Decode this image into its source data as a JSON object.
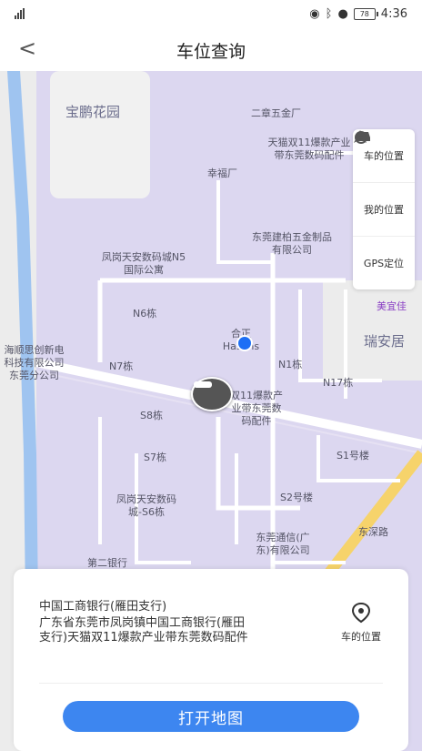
{
  "status_bar": {
    "time": "4:36",
    "battery": "78"
  },
  "header": {
    "back_label": "<",
    "title": "车位查询"
  },
  "map": {
    "pois": {
      "baopeng": "宝鹏花园",
      "erzhang": "二章五金厂",
      "tianmao": "天猫双11爆款产业带东莞数码配件",
      "xingfu": "幸福厂",
      "fenggang": "凤岗天安数码城N5国际公寓",
      "dongguan_jianbai": "东莞建柏五金制品有限公司",
      "meiyijia": "美宜佳",
      "n6": "N6栋",
      "hezheng": "合正Hasons",
      "ruian": "瑞安居",
      "n7": "N7栋",
      "n1": "N1栋",
      "n17": "N17栋",
      "keji": "海顺思创新电科技有限公司东莞分公司",
      "tianmao2": "双11爆款产业带东莞数码配件",
      "s8": "S8栋",
      "s7": "S7栋",
      "s1": "S1号楼",
      "s2": "S2号楼",
      "fenggang_s6": "凤岗天安数码城-S6栋",
      "dongfang_tongxin": "东莞通信(广东)有限公司",
      "dongshen": "东深路",
      "yinhang_map": "第二银行"
    }
  },
  "tools": {
    "car_position": "车的位置",
    "my_position": "我的位置",
    "gps": "GPS定位"
  },
  "card": {
    "bank_name": "中国工商银行(雁田支行)",
    "address": "广东省东莞市凤岗镇中国工商银行(雁田支行)天猫双11爆款产业带东莞数码配件",
    "car_position_label": "车的位置",
    "open_map_label": "打开地图"
  },
  "colors": {
    "accent": "#3d86f0",
    "map_land": "#dcd7f0",
    "road": "#ffffff",
    "river": "#9fc4f0"
  }
}
